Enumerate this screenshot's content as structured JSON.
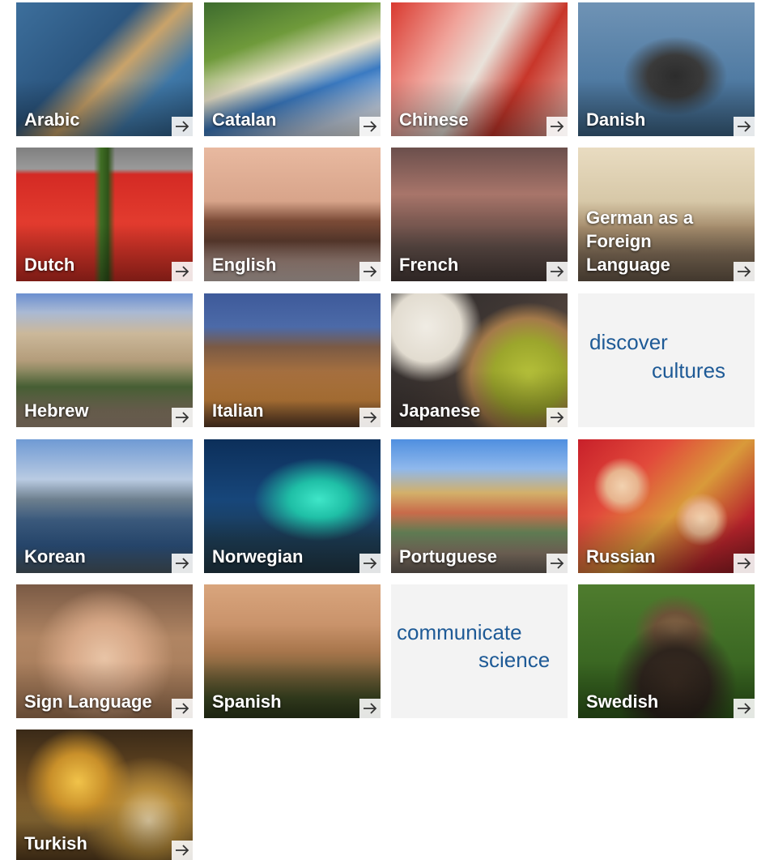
{
  "tiles": [
    {
      "label": "Arabic",
      "icon": "arrow-right-icon"
    },
    {
      "label": "Catalan",
      "icon": "arrow-right-icon"
    },
    {
      "label": "Chinese",
      "icon": "arrow-right-icon"
    },
    {
      "label": "Danish",
      "icon": "arrow-right-icon"
    },
    {
      "label": "Dutch",
      "icon": "arrow-right-icon"
    },
    {
      "label": "English",
      "icon": "arrow-right-icon"
    },
    {
      "label": "French",
      "icon": "arrow-right-icon"
    },
    {
      "label": "German as a\nForeign\nLanguage",
      "icon": "arrow-right-icon"
    },
    {
      "label": "Hebrew",
      "icon": "arrow-right-icon"
    },
    {
      "label": "Italian",
      "icon": "arrow-right-icon"
    },
    {
      "label": "Japanese",
      "icon": "arrow-right-icon"
    },
    {
      "label": "Korean",
      "icon": "arrow-right-icon"
    },
    {
      "label": "Norwegian",
      "icon": "arrow-right-icon"
    },
    {
      "label": "Portuguese",
      "icon": "arrow-right-icon"
    },
    {
      "label": "Russian",
      "icon": "arrow-right-icon"
    },
    {
      "label": "Sign Language",
      "icon": "arrow-right-icon"
    },
    {
      "label": "Spanish",
      "icon": "arrow-right-icon"
    },
    {
      "label": "Swedish",
      "icon": "arrow-right-icon"
    },
    {
      "label": "Turkish",
      "icon": "arrow-right-icon"
    }
  ],
  "promos": {
    "discover": {
      "line1": "discover",
      "line2": "cultures"
    },
    "communicate": {
      "line1": "communicate",
      "line2": "science"
    }
  },
  "colors": {
    "promo_text": "#1e5a96",
    "promo_bg": "#f3f3f3",
    "label_text": "#ffffff"
  }
}
